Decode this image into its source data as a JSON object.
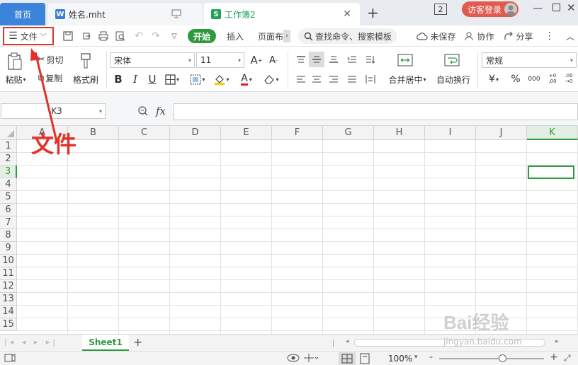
{
  "tabs": {
    "home": "首页",
    "doc": "姓名.mht",
    "workbook": "工作簿2",
    "doc_icon": "W",
    "wb_icon": "S",
    "badge": "2",
    "login": "访客登录"
  },
  "toolbar": {
    "file_menu": "文件",
    "tab_start": "开始",
    "tab_insert": "插入",
    "tab_page": "页面布",
    "search": "查找命令、搜索模板",
    "unsaved": "未保存",
    "collab": "协作",
    "share": "分享"
  },
  "ribbon": {
    "paste": "粘贴",
    "cut": "剪切",
    "copy": "复制",
    "format_painter": "格式刷",
    "font_name": "宋体",
    "font_size": "11",
    "bold": "B",
    "italic": "I",
    "underline": "U",
    "merge_center": "合并居中",
    "wrap_text": "自动换行",
    "number_format": "常规",
    "currency": "¥",
    "percent": "%",
    "thousands": "000",
    "inc_decimal": "+0 .00",
    "dec_decimal": ".00 →0",
    "font_grow": "A",
    "font_shrink": "A"
  },
  "formula_bar": {
    "cell_ref": "K3",
    "fx": "fx"
  },
  "grid": {
    "columns": [
      "A",
      "B",
      "C",
      "D",
      "E",
      "F",
      "G",
      "H",
      "I",
      "J",
      "K"
    ],
    "rows": [
      "1",
      "2",
      "3",
      "4",
      "5",
      "6",
      "7",
      "8",
      "9",
      "10",
      "11",
      "12",
      "13",
      "14",
      "15"
    ],
    "selected_column": "K",
    "selected_row": "3",
    "selected_cell": "K3"
  },
  "annotation": {
    "label": "文件",
    "color": "#e0312b"
  },
  "sheets": {
    "active": "Sheet1",
    "add": "+"
  },
  "status": {
    "zoom": "100%",
    "minus": "-",
    "plus": "+",
    "zoom_level": 0.6
  },
  "watermark": {
    "brand": "Bai经验",
    "url": "jingyan.baidu.com"
  },
  "colors": {
    "accent_green": "#2e9a3e",
    "tab_blue": "#3b84d9",
    "login_red": "#e05a4f"
  }
}
